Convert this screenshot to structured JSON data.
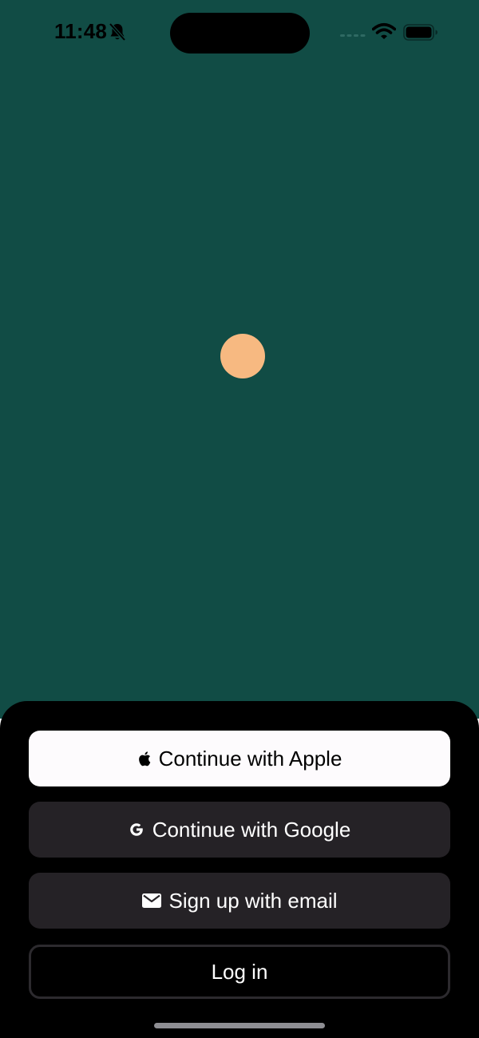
{
  "colors": {
    "hero_background": "#114c45",
    "loading_dot": "#f7b981",
    "sheet_background": "#000000",
    "primary_button_bg": "#fdfbfd",
    "primary_button_text": "#000000",
    "secondary_button_bg": "#252226",
    "secondary_button_text": "#ffffff",
    "outline_button_border": "#2c2a2e",
    "home_indicator": "#8e8e93"
  },
  "status_bar": {
    "time": "11:48",
    "icons": [
      "bell-slash-icon",
      "signal-icon",
      "wifi-icon",
      "battery-icon"
    ]
  },
  "auth": {
    "apple": {
      "label": "Continue with Apple",
      "icon": "apple-icon"
    },
    "google": {
      "label": "Continue with Google",
      "icon": "google-icon"
    },
    "email": {
      "label": "Sign up with email",
      "icon": "envelope-icon"
    },
    "login": {
      "label": "Log in"
    }
  }
}
